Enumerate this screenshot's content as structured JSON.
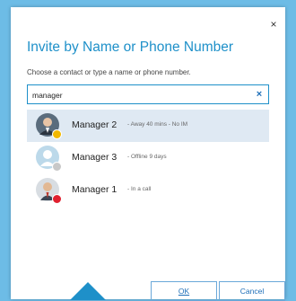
{
  "dialog": {
    "title": "Invite by Name or Phone Number",
    "instruction": "Choose a contact or type a name or phone number.",
    "close_label": "×",
    "search": {
      "value": "manager",
      "clear_label": "×"
    },
    "results": [
      {
        "name": "Manager 2",
        "status": "- Away 40 mins - No IM",
        "presence": "away",
        "presence_color": "#f2b800",
        "avatar": "photo",
        "selected": true
      },
      {
        "name": "Manager 3",
        "status": "- Offline 9 days",
        "presence": "offline",
        "presence_color": "#c8c8c8",
        "avatar": "placeholder",
        "selected": false
      },
      {
        "name": "Manager 1",
        "status": "- In a call",
        "presence": "busy",
        "presence_color": "#e0202f",
        "avatar": "photo",
        "selected": false
      }
    ],
    "ok_label": "OK",
    "cancel_label": "Cancel"
  },
  "colors": {
    "accent": "#1e90c9",
    "background": "#6dbce6",
    "selected_row": "#dfe9f3"
  }
}
